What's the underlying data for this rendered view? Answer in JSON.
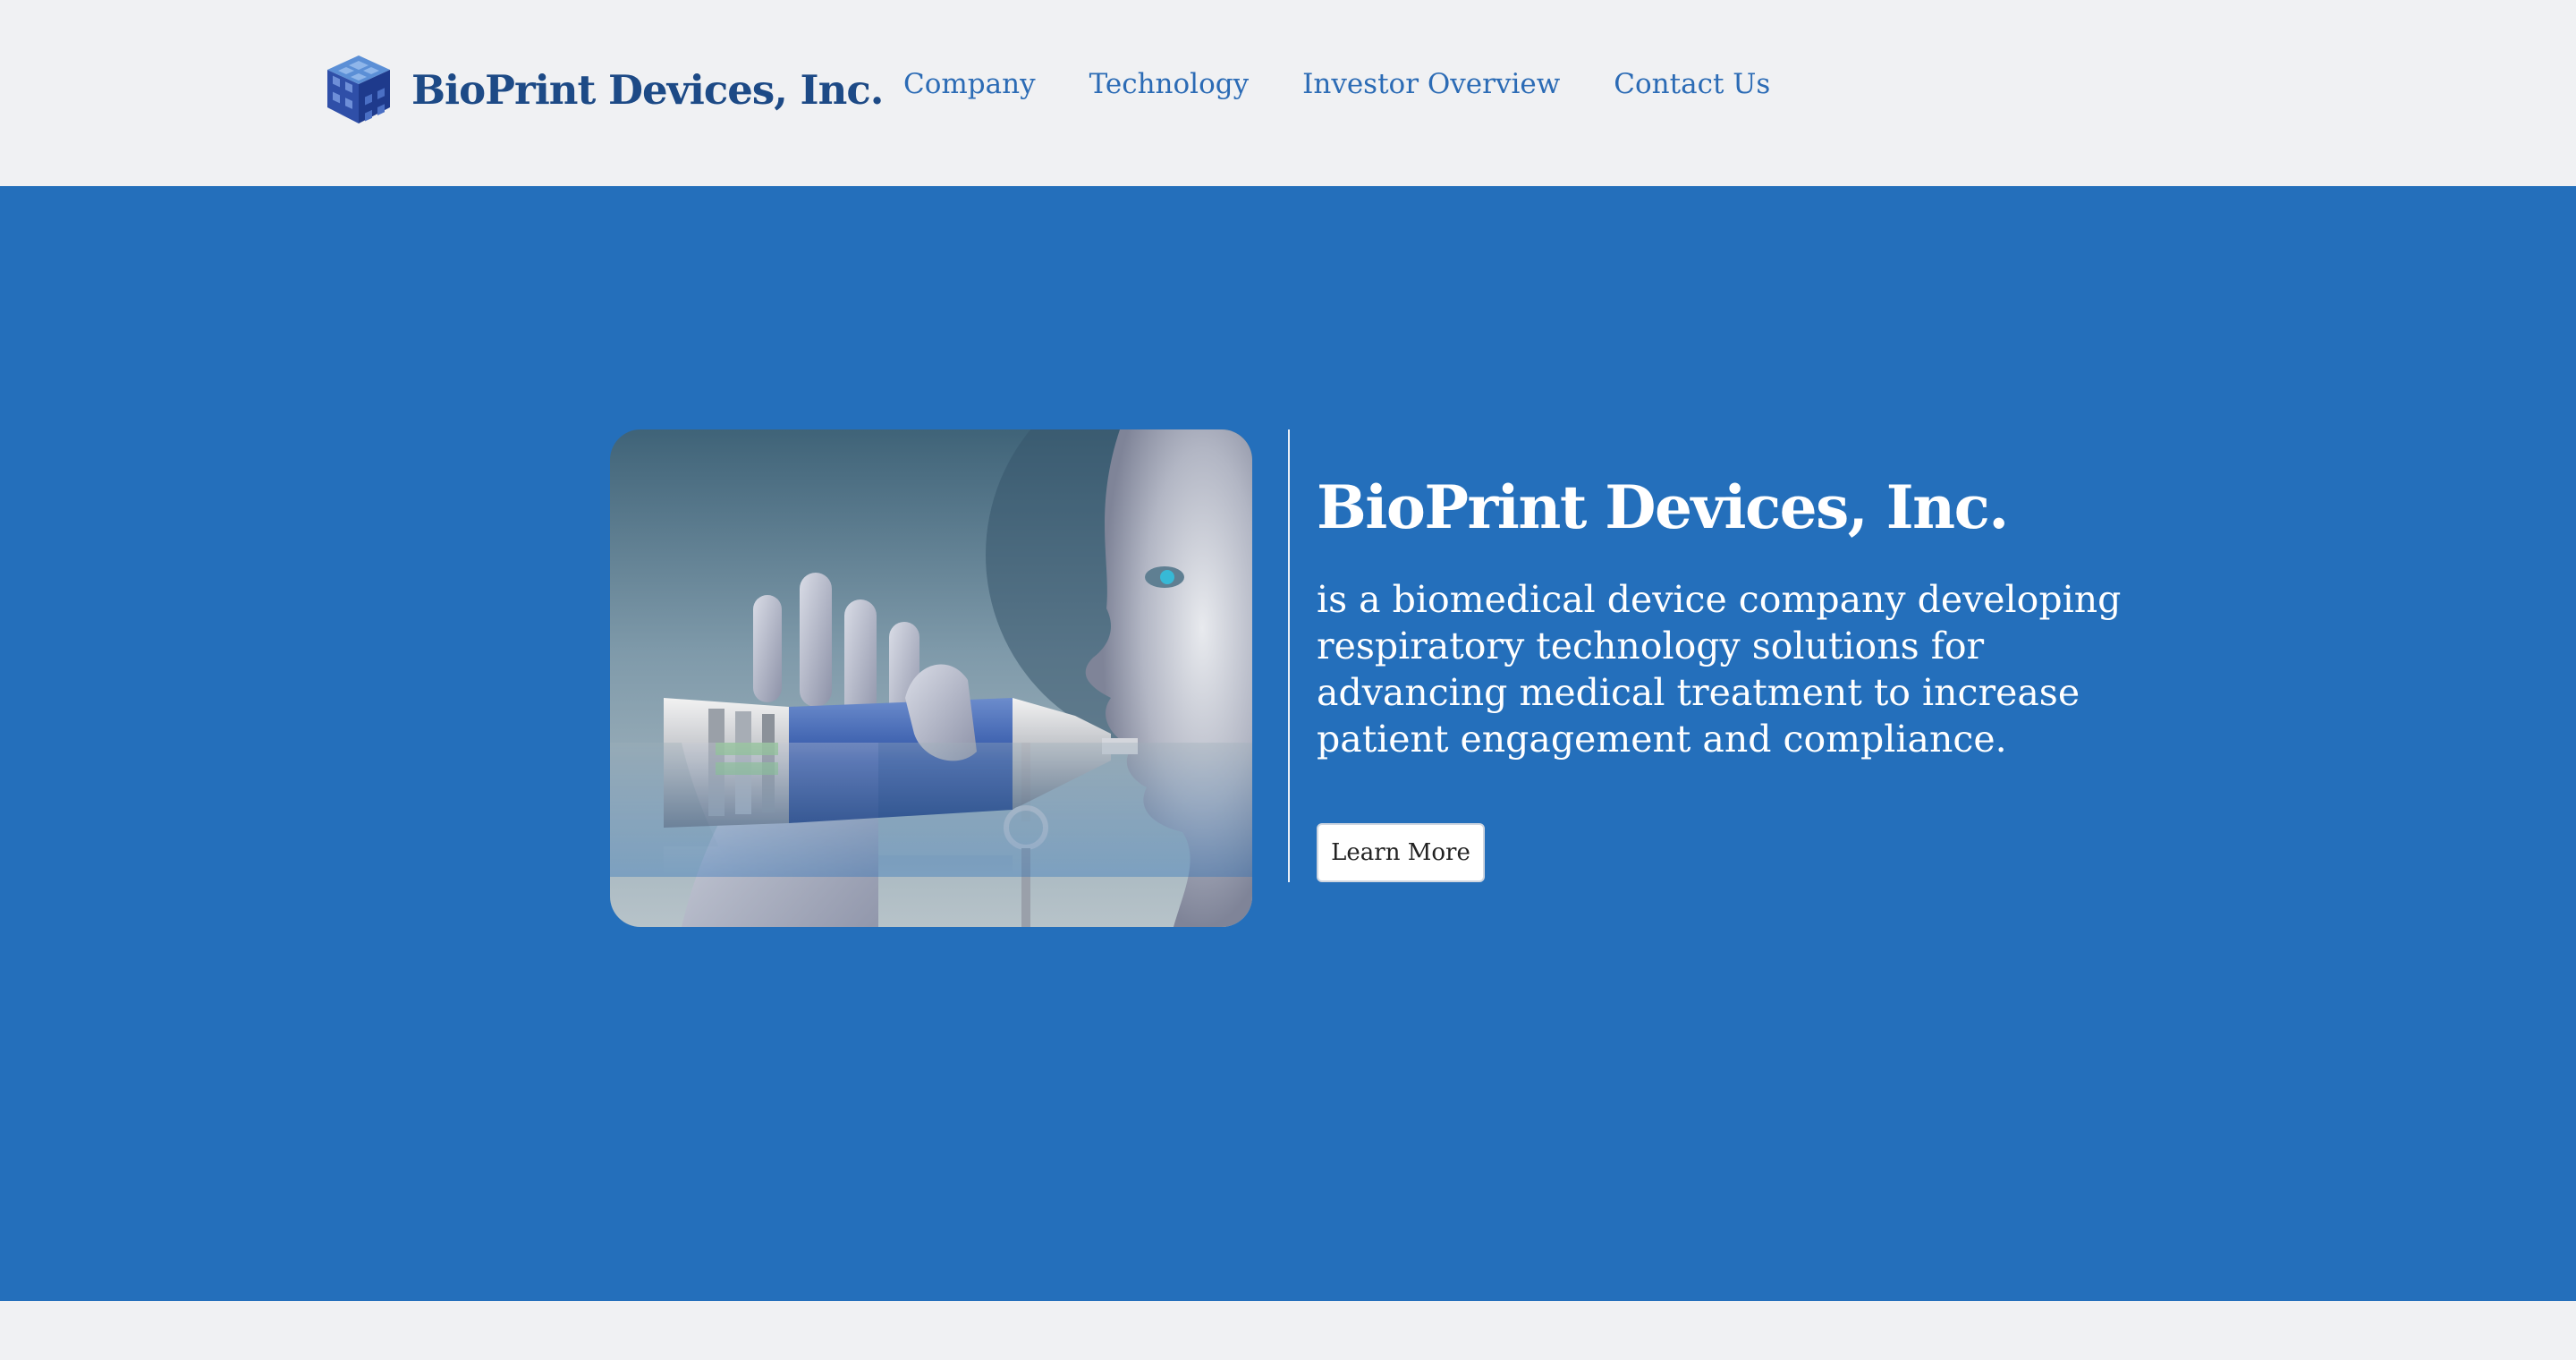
{
  "header": {
    "brand_name": "BioPrint Devices, Inc.",
    "logo_icon": "cube-logo-icon",
    "nav": [
      {
        "label": "Company"
      },
      {
        "label": "Technology"
      },
      {
        "label": "Investor Overview"
      },
      {
        "label": "Contact Us"
      }
    ]
  },
  "hero": {
    "image_subject": "inhaler-device-image",
    "title": "BioPrint Devices, Inc.",
    "description": "is a biomedical device company developing respiratory technology solutions for advancing medical treatment to increase patient engagement and compliance.",
    "cta_label": "Learn More"
  },
  "colors": {
    "hero_background": "#246fbb",
    "header_background": "#f0f1f3",
    "brand_text": "#1d4a86",
    "nav_text": "#2b6bb5",
    "hero_text": "#ffffff"
  }
}
